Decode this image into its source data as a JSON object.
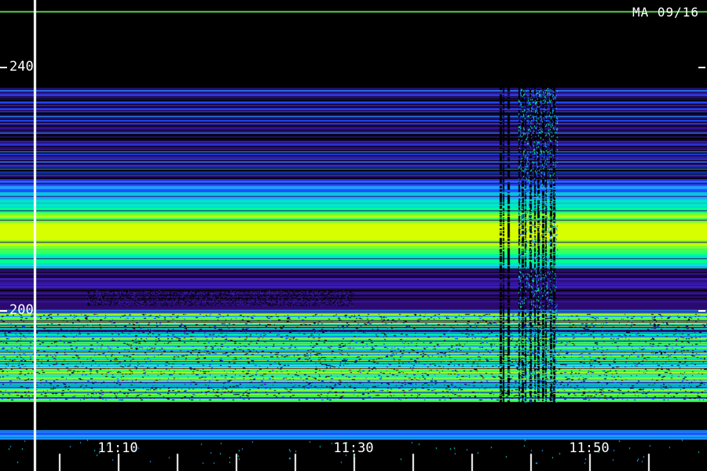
{
  "header": {
    "station_label": "MA 09/16"
  },
  "axes": {
    "y_ticks": [
      {
        "label": "240",
        "value": 240
      },
      {
        "label": "200",
        "value": 200
      }
    ],
    "x_ticks": [
      {
        "label": "11:10",
        "value": "11:10"
      },
      {
        "label": "11:30",
        "value": "11:30"
      },
      {
        "label": "11:50",
        "value": "11:50"
      }
    ]
  },
  "colors": {
    "background": "#000000",
    "cursor_line": "#ffffff",
    "top_reference_line": "#4fd24f",
    "palette": [
      "#2a0a6e",
      "#3b1fb8",
      "#1c4fff",
      "#1ea0ff",
      "#00e0d0",
      "#00ff8c",
      "#7dff2a",
      "#d8ff00"
    ]
  },
  "chart_data": {
    "type": "heatmap",
    "x_unit": "time",
    "y_unit": "frequency",
    "x_ticks": [
      "11:10",
      "11:30",
      "11:50"
    ],
    "y_ticks": [
      240,
      200
    ]
  }
}
